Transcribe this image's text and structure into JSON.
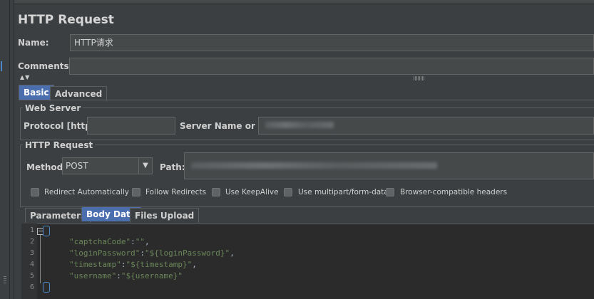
{
  "panel_title": "HTTP Request",
  "name": {
    "label": "Name:",
    "value": "HTTP请求"
  },
  "comments": {
    "label": "Comments:",
    "value": ""
  },
  "top_tabs": [
    {
      "label": "Basic",
      "selected": true
    },
    {
      "label": "Advanced",
      "selected": false
    }
  ],
  "web_server": {
    "title": "Web Server",
    "protocol_label": "Protocol [http]:",
    "protocol_value": "",
    "server_label": "Server Name or IP:"
  },
  "http_request": {
    "title": "HTTP Request",
    "method_label": "Method:",
    "method_value": "POST",
    "path_label": "Path:"
  },
  "options": [
    {
      "label": "Redirect Automatically",
      "checked": false
    },
    {
      "label": "Follow Redirects",
      "checked": false
    },
    {
      "label": "Use KeepAlive",
      "checked": false
    },
    {
      "label": "Use multipart/form-data",
      "checked": false
    },
    {
      "label": "Browser-compatible headers",
      "checked": false
    }
  ],
  "body_tabs": [
    {
      "label": "Parameters",
      "selected": false
    },
    {
      "label": "Body Data",
      "selected": true
    },
    {
      "label": "Files Upload",
      "selected": false
    }
  ],
  "body_code": {
    "line_numbers": [
      "1",
      "2",
      "3",
      "4",
      "5",
      "6"
    ],
    "line2": {
      "key": "\"captchaCode\"",
      "sep": ":",
      "val": "\"\"",
      "end": ","
    },
    "line3": {
      "key": "\"loginPassword\"",
      "sep": ":",
      "val": "\"${loginPassword}\"",
      "end": ","
    },
    "line4": {
      "key": "\"timestamp\"",
      "sep": ":",
      "val": "\"${timestamp}\"",
      "end": ","
    },
    "line5": {
      "key": "\"username\"",
      "sep": ":",
      "val": "\"${username}\"",
      "end": ""
    }
  },
  "colors": {
    "background": "#3c3f41",
    "editor_background": "#2b2b2b",
    "selected_tab": "#4b6eaf",
    "string_green": "#6a8759"
  },
  "icons": {
    "collapse": "collapse-arrows-icon",
    "dropdown": "chevron-down-icon",
    "fold": "fold-minus-icon"
  }
}
